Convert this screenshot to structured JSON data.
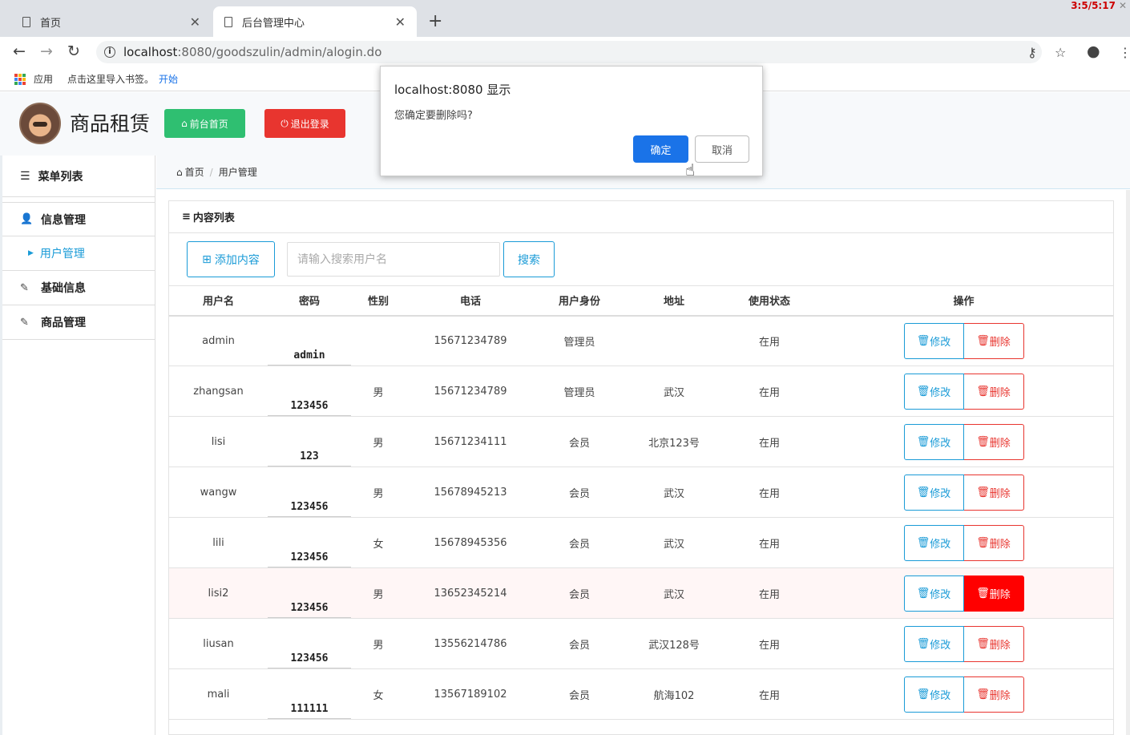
{
  "browser": {
    "tabs": [
      {
        "label": "首页"
      },
      {
        "label": "后台管理中心"
      }
    ],
    "window_badge": "3:5/5:17",
    "url_host": "localhost",
    "url_path": ":8080/goodszulin/admin/alogin.do",
    "bookmarks": {
      "apps": "应用",
      "import_hint": "点击这里导入书签。",
      "start": "开始"
    }
  },
  "header": {
    "site_title": "商品租赁",
    "front_btn": "前台首页",
    "logout_btn": "退出登录"
  },
  "sidebar": {
    "title": "菜单列表",
    "items": [
      {
        "label": "信息管理"
      },
      {
        "label": "用户管理"
      },
      {
        "label": "基础信息"
      },
      {
        "label": "商品管理"
      }
    ]
  },
  "breadcrumb": {
    "home": "首页",
    "current": "用户管理"
  },
  "panel": {
    "title": "内容列表",
    "add_btn": "添加内容",
    "search_placeholder": "请输入搜索用户名",
    "search_btn": "搜索"
  },
  "table": {
    "headers": [
      "用户名",
      "密码",
      "性别",
      "电话",
      "用户身份",
      "地址",
      "使用状态",
      "操作"
    ],
    "edit_label": "修改",
    "delete_label": "删除",
    "rows": [
      {
        "username": "admin",
        "password": "admin",
        "gender": "",
        "phone": "15671234789",
        "role": "管理员",
        "address": "",
        "status": "在用"
      },
      {
        "username": "zhangsan",
        "password": "123456",
        "gender": "男",
        "phone": "15671234789",
        "role": "管理员",
        "address": "武汉",
        "status": "在用"
      },
      {
        "username": "lisi",
        "password": "123",
        "gender": "男",
        "phone": "15671234111",
        "role": "会员",
        "address": "北京123号",
        "status": "在用"
      },
      {
        "username": "wangw",
        "password": "123456",
        "gender": "男",
        "phone": "15678945213",
        "role": "会员",
        "address": "武汉",
        "status": "在用"
      },
      {
        "username": "lili",
        "password": "123456",
        "gender": "女",
        "phone": "15678945356",
        "role": "会员",
        "address": "武汉",
        "status": "在用"
      },
      {
        "username": "lisi2",
        "password": "123456",
        "gender": "男",
        "phone": "13652345214",
        "role": "会员",
        "address": "武汉",
        "status": "在用"
      },
      {
        "username": "liusan",
        "password": "123456",
        "gender": "男",
        "phone": "13556214786",
        "role": "会员",
        "address": "武汉128号",
        "status": "在用"
      },
      {
        "username": "mali",
        "password": "111111",
        "gender": "女",
        "phone": "13567189102",
        "role": "会员",
        "address": "航海102",
        "status": "在用"
      }
    ]
  },
  "dialog": {
    "title": "localhost:8080 显示",
    "message": "您确定要删除吗?",
    "ok": "确定",
    "cancel": "取消"
  },
  "colors": {
    "accent": "#1a9bd7",
    "danger": "#e8352f",
    "success": "#2fbf71",
    "dialog_ok": "#1a73e8"
  }
}
